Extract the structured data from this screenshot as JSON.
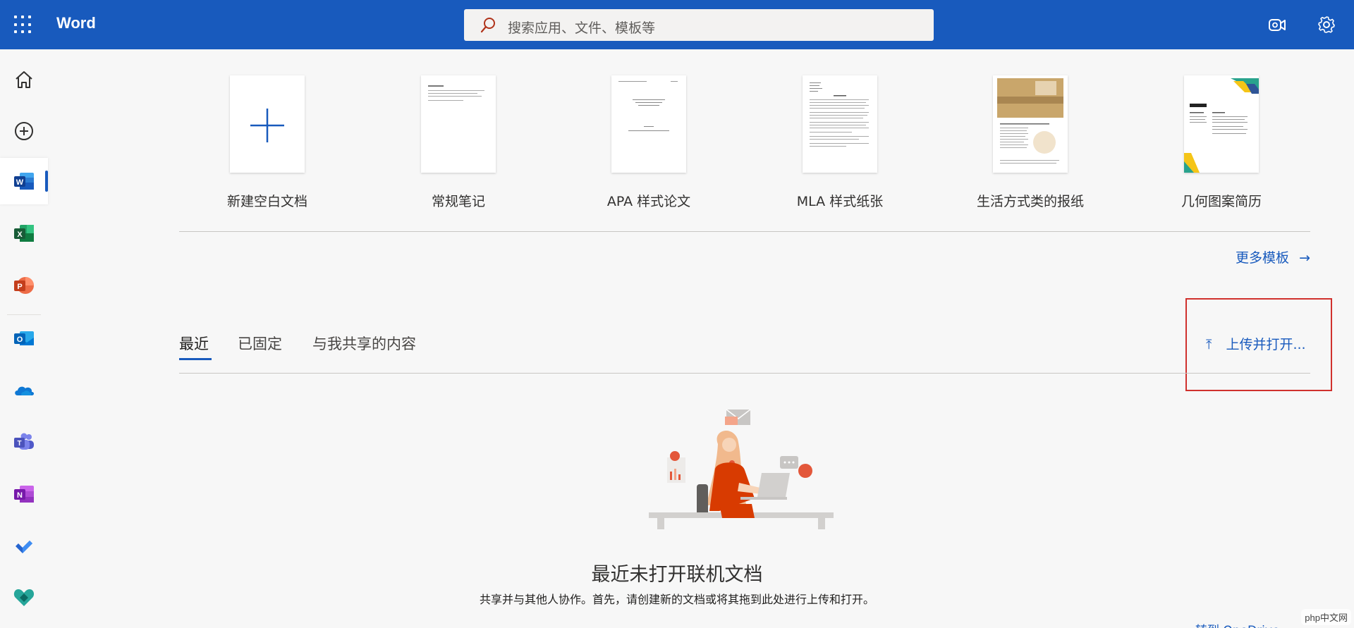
{
  "header": {
    "app_name": "Word",
    "search_placeholder": "搜索应用、文件、模板等",
    "colors": {
      "brand": "#185abd"
    }
  },
  "rail": {
    "items": [
      {
        "name": "home",
        "icon": "home-icon"
      },
      {
        "name": "create",
        "icon": "add-circle-icon"
      },
      {
        "name": "word",
        "icon": "word-icon",
        "active": true
      },
      {
        "name": "excel",
        "icon": "excel-icon"
      },
      {
        "name": "powerpoint",
        "icon": "powerpoint-icon"
      },
      {
        "name": "outlook",
        "icon": "outlook-icon"
      },
      {
        "name": "onedrive",
        "icon": "onedrive-icon"
      },
      {
        "name": "teams",
        "icon": "teams-icon"
      },
      {
        "name": "onenote",
        "icon": "onenote-icon"
      },
      {
        "name": "todo",
        "icon": "todo-icon"
      },
      {
        "name": "family-safety",
        "icon": "family-safety-icon"
      }
    ]
  },
  "templates": {
    "items": [
      {
        "label": "新建空白文档"
      },
      {
        "label": "常规笔记"
      },
      {
        "label": "APA 样式论文"
      },
      {
        "label": "MLA 样式纸张"
      },
      {
        "label": "生活方式类的报纸"
      },
      {
        "label": "几何图案简历"
      }
    ],
    "more_label": "更多模板"
  },
  "tabs": {
    "items": [
      {
        "label": "最近"
      },
      {
        "label": "已固定"
      },
      {
        "label": "与我共享的内容"
      }
    ],
    "upload_label": "上传并打开..."
  },
  "empty_state": {
    "title": "最近未打开联机文档",
    "subtitle": "共享并与其他人协作。首先，请创建新的文档或将其拖到此处进行上传和打开。"
  },
  "footer": {
    "partial_link": "转到 OneDrive",
    "watermark": "php中文网"
  }
}
